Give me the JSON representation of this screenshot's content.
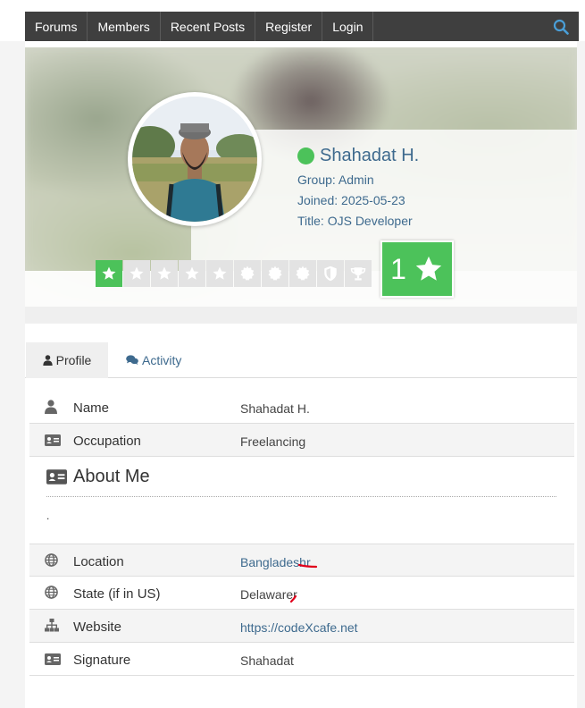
{
  "nav": {
    "items": [
      "Forums",
      "Members",
      "Recent Posts",
      "Register",
      "Login"
    ],
    "search_icon": "search-icon"
  },
  "profile": {
    "name": "Shahadat H.",
    "status": "online",
    "group": "Group: Admin",
    "joined": "Joined: 2025-05-23",
    "title": "Title: OJS Developer",
    "rank_number": "1",
    "rank_icons": [
      "star",
      "star",
      "star",
      "star",
      "star",
      "badge",
      "badge",
      "badge",
      "shield",
      "trophy"
    ],
    "rank_active_count": 1
  },
  "tabs": [
    {
      "label": "Profile",
      "icon": "user-icon",
      "active": true
    },
    {
      "label": "Activity",
      "icon": "comments-icon",
      "active": false
    }
  ],
  "fields": {
    "name": {
      "label": "Name",
      "value": "Shahadat H."
    },
    "occupation": {
      "label": "Occupation",
      "value": "Freelancing"
    },
    "location": {
      "label": "Location",
      "value": "Bangladeshr"
    },
    "state": {
      "label": "State (if in US)",
      "value": "Delawarer"
    },
    "website": {
      "label": "Website",
      "value": "https://codeXcafe.net"
    },
    "signature": {
      "label": "Signature",
      "value": "Shahadat"
    }
  },
  "about": {
    "heading": "About Me",
    "text": "."
  },
  "colors": {
    "nav_bg": "#3f3f3f",
    "accent_green": "#4cc25a",
    "link_blue": "#3e6a8e",
    "search_blue": "#4a9fd8",
    "annotation_red": "#e0001b"
  }
}
